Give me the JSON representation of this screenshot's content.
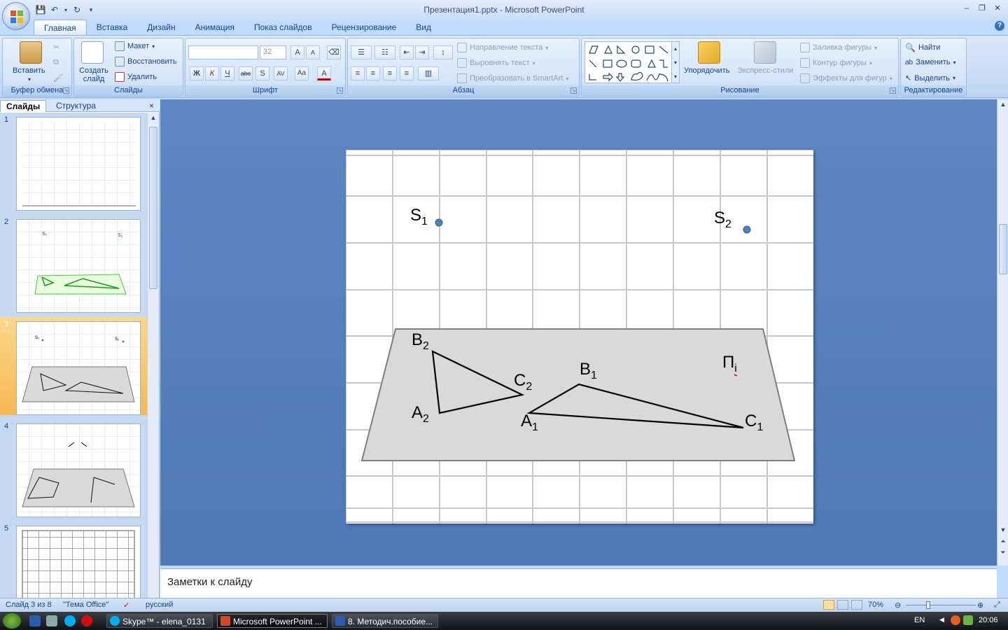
{
  "window": {
    "title": "Презентация1.pptx - Microsoft PowerPoint",
    "minimize": "‒",
    "restore": "❐",
    "close": "✕"
  },
  "qat": {
    "save": "💾",
    "undo": "↶",
    "redo": "↻",
    "more": "▾"
  },
  "tabs": [
    "Главная",
    "Вставка",
    "Дизайн",
    "Анимация",
    "Показ слайдов",
    "Рецензирование",
    "Вид"
  ],
  "ribbon": {
    "clipboard": {
      "label": "Буфер обмена",
      "paste": "Вставить"
    },
    "slides": {
      "label": "Слайды",
      "new_slide": "Создать слайд",
      "layout": "Макет",
      "reset": "Восстановить",
      "delete": "Удалить"
    },
    "font": {
      "label": "Шрифт",
      "font_name": "",
      "font_size": "32"
    },
    "paragraph": {
      "label": "Абзац",
      "text_direction": "Направление текста",
      "align_text": "Выровнять текст",
      "smartart": "Преобразовать в SmartArt"
    },
    "drawing": {
      "label": "Рисование",
      "arrange": "Упорядочить",
      "quick_styles": "Экспресс-стили",
      "shape_fill": "Заливка фигуры",
      "shape_outline": "Контур фигуры",
      "shape_effects": "Эффекты для фигур"
    },
    "editing": {
      "label": "Редактирование",
      "find": "Найти",
      "replace": "Заменить",
      "select": "Выделить"
    }
  },
  "panel": {
    "tab_slides": "Слайды",
    "tab_outline": "Структура",
    "close": "×",
    "thumbnails": [
      "1",
      "2",
      "3",
      "4",
      "5"
    ],
    "selected": 3
  },
  "slide": {
    "labels": {
      "s1": "S",
      "s1_sub": "1",
      "s2": "S",
      "s2_sub": "2",
      "b2": "B",
      "b2_sub": "2",
      "c2": "C",
      "c2_sub": "2",
      "a2": "A",
      "a2_sub": "2",
      "b1": "B",
      "b1_sub": "1",
      "a1": "A",
      "a1_sub": "1",
      "c1": "C",
      "c1_sub": "1",
      "pi": "П",
      "pi_sub": "i"
    },
    "colors": {
      "plane_fill": "#d9d9d9",
      "point": "#4f81bd",
      "grid": "#c8c8c8"
    }
  },
  "notes": {
    "placeholder": "Заметки к слайду"
  },
  "status": {
    "slide_info": "Слайд 3 из 8",
    "theme": "\"Тема Office\"",
    "language": "русский",
    "zoom": "70%"
  },
  "taskbar": {
    "tasks": [
      "Skype™ - elena_0131",
      "Microsoft PowerPoint ...",
      "8. Методич.пособие..."
    ],
    "lang": "EN",
    "time": "20:06"
  }
}
